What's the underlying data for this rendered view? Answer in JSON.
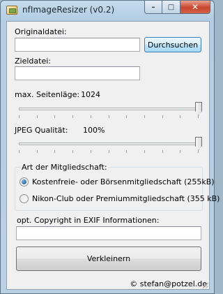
{
  "window": {
    "title": "nfImageResizer (v0.2)",
    "caption": {
      "minimize": "–",
      "maximize": "□",
      "close": "✕"
    }
  },
  "source": {
    "label": "Originaldatei:",
    "value": "",
    "browse_label": "Durchsuchen"
  },
  "target": {
    "label": "Zieldatei:",
    "value": ""
  },
  "max_side": {
    "label": "max. Seitenläge:",
    "value": "1024",
    "level": 1.0
  },
  "jpeg_quality": {
    "label": "JPEG Qualität:",
    "value": "100%",
    "level": 1.0
  },
  "membership": {
    "title": "Art der Mitgliedschaft:",
    "options": [
      {
        "label": "Kostenfreie- oder Börsenmitgliedschaft (255kB)",
        "selected": true
      },
      {
        "label": "Nikon-Club oder Premiummitgliedschaft (355 kB)",
        "selected": false
      }
    ]
  },
  "copyright": {
    "label": "opt. Copyright in EXIF Informationen:",
    "value": ""
  },
  "action": {
    "label": "Verkleinern"
  },
  "footer": {
    "credit": "© stefan@potzel.de"
  },
  "icons": {
    "app": "image-resizer-icon",
    "radio_selected": "radio-selected",
    "radio_unselected": "radio-unselected"
  },
  "colors": {
    "titlebar": "#b9d0e4",
    "client": "#f0f0f0",
    "close_button": "#c7452c",
    "default_button": "#a7d9f5"
  }
}
